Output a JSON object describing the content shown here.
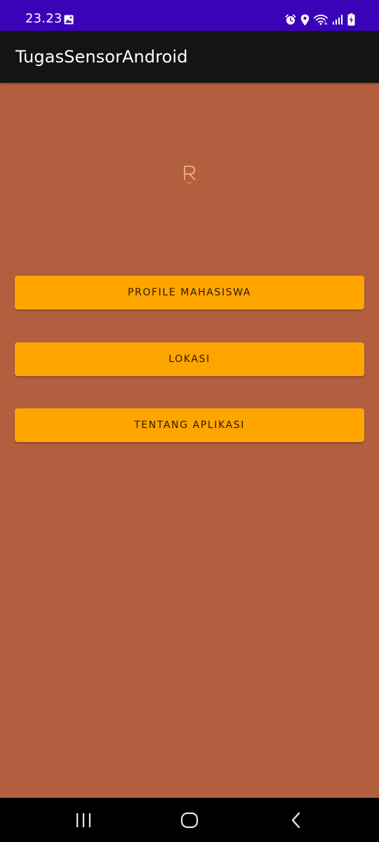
{
  "status_bar": {
    "time": "23.23",
    "left_icons": [
      "gallery-icon"
    ],
    "right_icons": [
      "alarm-icon",
      "location-icon",
      "wifi-icon",
      "signal-icon",
      "battery-charging-icon"
    ],
    "background": "#3a03b8"
  },
  "app_bar": {
    "title": "TugasSensorAndroid",
    "background": "#141414"
  },
  "main": {
    "background": "#b25f3f",
    "logo": {
      "letter": "R",
      "color": "#f2c27a"
    },
    "buttons": [
      {
        "label": "PROFILE MAHASISWA"
      },
      {
        "label": "LOKASI"
      },
      {
        "label": "TENTANG APLIKASI"
      }
    ],
    "button_color": "#ffa500"
  },
  "nav_bar": {
    "items": [
      "recents-icon",
      "home-icon",
      "back-icon"
    ],
    "background": "#000000"
  }
}
